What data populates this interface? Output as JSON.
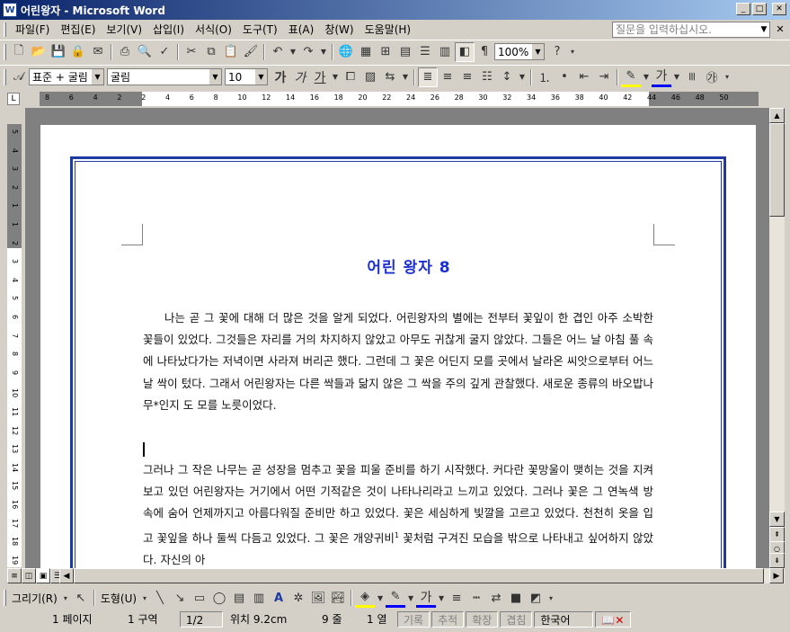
{
  "window": {
    "title": "어린왕자 - Microsoft Word",
    "icon": "W"
  },
  "menus": [
    "파일(F)",
    "편집(E)",
    "보기(V)",
    "삽입(I)",
    "서식(O)",
    "도구(T)",
    "표(A)",
    "창(W)",
    "도움말(H)"
  ],
  "help_box": {
    "placeholder": "질문을 입력하십시오."
  },
  "standard_toolbar": {
    "buttons": [
      "new-icon",
      "open-icon",
      "save-icon",
      "permission-icon",
      "email-icon",
      "print-icon",
      "print-preview-icon",
      "spelling-icon",
      "cut-icon",
      "copy-icon",
      "paste-icon",
      "format-painter-icon",
      "undo-icon",
      "redo-icon",
      "hyperlink-icon",
      "tables-borders-icon",
      "insert-table-icon",
      "insert-excel-icon",
      "columns-icon",
      "drawing-icon",
      "document-map-icon",
      "show-hide-icon"
    ],
    "zoom": "100%"
  },
  "formatting_toolbar": {
    "style": "표준 + 굴림",
    "font": "굴림",
    "size": "10",
    "bold": "가",
    "italic": "가",
    "underline": "가"
  },
  "ruler": {
    "numbers": [
      "8",
      "6",
      "4",
      "2",
      "2",
      "4",
      "6",
      "8",
      "10",
      "12",
      "14",
      "16",
      "18",
      "20",
      "22",
      "24",
      "26",
      "28",
      "30",
      "32",
      "34",
      "36",
      "38",
      "40",
      "42",
      "44",
      "46",
      "48",
      "50"
    ],
    "vnumbers": [
      "5",
      "4",
      "3",
      "2",
      "1",
      "1",
      "2",
      "3",
      "4",
      "5",
      "6",
      "7",
      "8",
      "9",
      "10",
      "11",
      "12",
      "13",
      "14",
      "15",
      "16",
      "17",
      "18",
      "19"
    ]
  },
  "document": {
    "title": "어린 왕자 8",
    "p1": "나는 곧 그 꽃에 대해 더 많은 것을 알게 되었다. 어린왕자의 별에는 전부터 꽃잎이 한 겹인 아주 소박한 꽃들이 있었다. 그것들은 자리를 거의 차지하지 않았고 아무도 귀찮게 굴지 않았다. 그들은 어느 날 아침 풀 속에 나타났다가는 저녁이면 사라져 버리곤 했다. 그런데 그 꽃은 어딘지 모를 곳에서 날라온 씨앗으로부터 어느 날 싹이 텄다. 그래서 어린왕자는 다른 싹들과 닮지 않은 그 싹을 주의 깊게 관찰했다. 새로운 종류의 바오밥나무*인지 도 모를 노릇이었다.",
    "p2_a": "그러나 그 작은 나무는 곧 성장을 멈추고 꽃을 피울 준비를 하기 시작했다. 커다란 꽃망울이 맺히는 것을 지켜보고 있던 어린왕자는 거기에서 어떤 기적같은 것이 나타나리라고 느끼고 있었다. 그러나 꽃은 그 연녹색 방 속에 숨어 언제까지고 아름다워질 준비만 하고 있었다. 꽃은 세심하게 빛깔을 고르고 있었다. 천천히 옷을 입고 꽃잎을 하나 둘씩 다듬고 있었다. 그 꽃은 개양귀비",
    "p2_sup": "1",
    "p2_b": " 꽃처럼 구겨진 모습을 밖으로 나타내고 싶어하지 않았다. 자신의 아"
  },
  "drawing_toolbar": {
    "draw": "그리기(R)",
    "autoshapes": "도형(U)"
  },
  "status": {
    "page": "1 페이지",
    "section": "1 구역",
    "pages": "1/2",
    "position": "위치 9.2cm",
    "line": "9 줄",
    "col": "1 열",
    "rec": "기록",
    "trk": "추적",
    "ext": "확장",
    "ovr": "겹침",
    "lang": "한국어"
  },
  "colors": {
    "title_blue": "#1c2fd0",
    "border_blue": "#1c3aa0",
    "titlebar": "#0a246a"
  }
}
